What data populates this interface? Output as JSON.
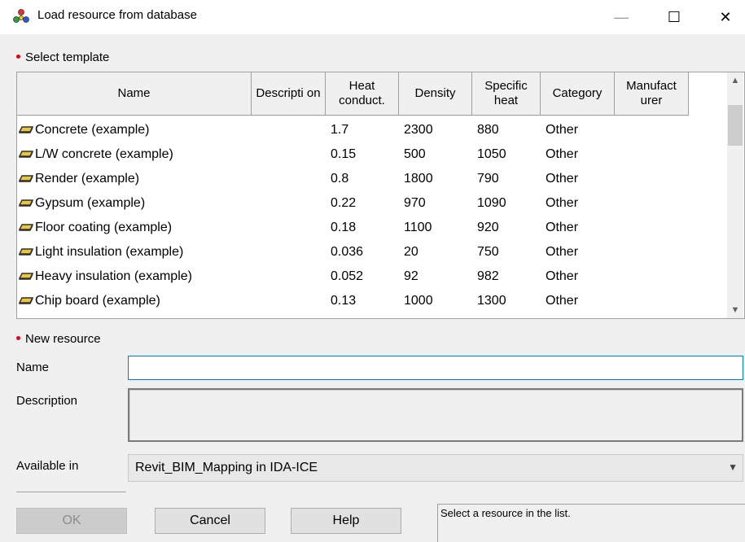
{
  "window": {
    "title": "Load resource from database",
    "minimize": "—",
    "maximize": "☐",
    "close": "✕"
  },
  "template_section": {
    "label": "Select template",
    "columns": [
      "Name",
      "Descripti on",
      "Heat conduct.",
      "Density",
      "Specific heat",
      "Category",
      "Manufact urer"
    ],
    "rows": [
      {
        "name": "Concrete (example)",
        "description": "",
        "heat": "1.7",
        "density": "2300",
        "specific": "880",
        "category": "Other",
        "manufacturer": ""
      },
      {
        "name": "L/W concrete (example)",
        "description": "",
        "heat": "0.15",
        "density": "500",
        "specific": "1050",
        "category": "Other",
        "manufacturer": ""
      },
      {
        "name": "Render (example)",
        "description": "",
        "heat": "0.8",
        "density": "1800",
        "specific": "790",
        "category": "Other",
        "manufacturer": ""
      },
      {
        "name": "Gypsum (example)",
        "description": "",
        "heat": "0.22",
        "density": "970",
        "specific": "1090",
        "category": "Other",
        "manufacturer": ""
      },
      {
        "name": "Floor coating (example)",
        "description": "",
        "heat": "0.18",
        "density": "1100",
        "specific": "920",
        "category": "Other",
        "manufacturer": ""
      },
      {
        "name": "Light insulation (example)",
        "description": "",
        "heat": "0.036",
        "density": "20",
        "specific": "750",
        "category": "Other",
        "manufacturer": ""
      },
      {
        "name": "Heavy insulation (example)",
        "description": "",
        "heat": "0.052",
        "density": "92",
        "specific": "982",
        "category": "Other",
        "manufacturer": ""
      },
      {
        "name": "Chip board (example)",
        "description": "",
        "heat": "0.13",
        "density": "1000",
        "specific": "1300",
        "category": "Other",
        "manufacturer": ""
      }
    ]
  },
  "new_resource": {
    "label": "New resource",
    "name_label": "Name",
    "name_value": "",
    "description_label": "Description",
    "description_value": "",
    "available_label": "Available in",
    "available_value": "Revit_BIM_Mapping in IDA-ICE"
  },
  "buttons": {
    "ok": "OK",
    "cancel": "Cancel",
    "help": "Help"
  },
  "status": "Select a resource in the list.",
  "colors": {
    "bullet": "#e0001a",
    "material_icon": "#2f2f2f",
    "input_focus_border": "#0078d7"
  },
  "icons": {
    "app": "resource-database-icon",
    "row": "material-brick-icon"
  }
}
